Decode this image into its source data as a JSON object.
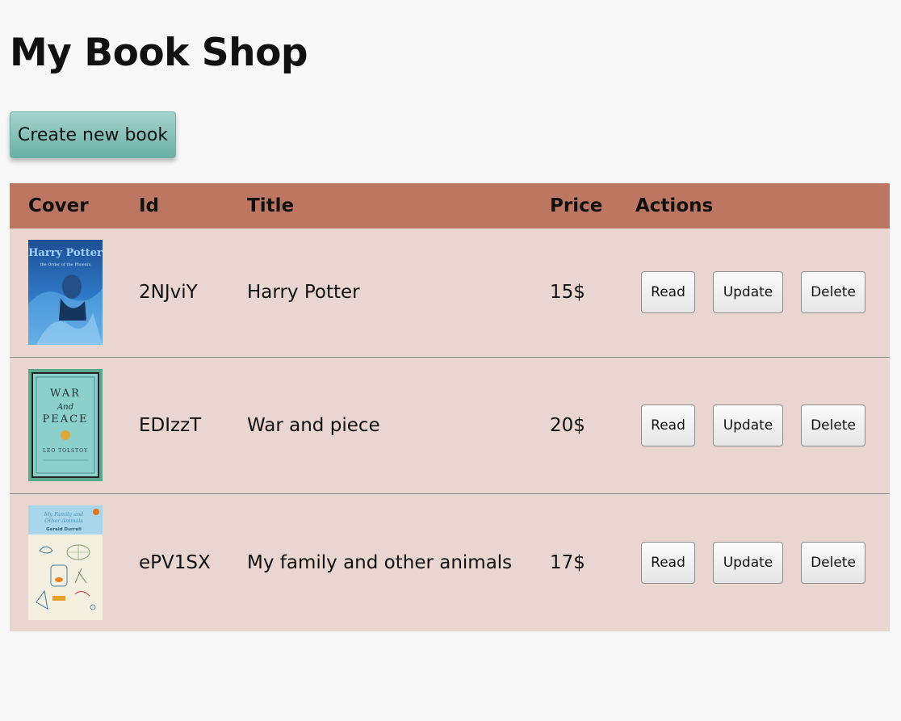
{
  "page": {
    "title": "My Book Shop",
    "create_label": "Create new book"
  },
  "table": {
    "headers": [
      "Cover",
      "Id",
      "Title",
      "Price",
      "Actions"
    ],
    "rows": [
      {
        "id": "2NJviY",
        "title": "Harry Potter",
        "price": "15$",
        "cover": {
          "kind": "hp",
          "text1": "Harry Potter",
          "text2": "the Order of the Phoenix"
        },
        "actions": {
          "read": "Read",
          "update": "Update",
          "delete": "Delete"
        }
      },
      {
        "id": "EDIzzT",
        "title": "War and piece",
        "price": "20$",
        "cover": {
          "kind": "wp",
          "line1": "WAR",
          "line2": "And",
          "line3": "PEACE",
          "author": "LEO TOLSTOY"
        },
        "actions": {
          "read": "Read",
          "update": "Update",
          "delete": "Delete"
        }
      },
      {
        "id": "ePV1SX",
        "title": "My family and other animals",
        "price": "17$",
        "cover": {
          "kind": "fa",
          "line1": "My Family and",
          "line2": "Other Animals",
          "author": "Gerald Durrell"
        },
        "actions": {
          "read": "Read",
          "update": "Update",
          "delete": "Delete"
        }
      }
    ]
  },
  "colors": {
    "header_bg": "#bd7662",
    "row_bg": "#e9d6d1",
    "create_button": "#6ab0a6",
    "page_bg": "#f8f8f8"
  }
}
